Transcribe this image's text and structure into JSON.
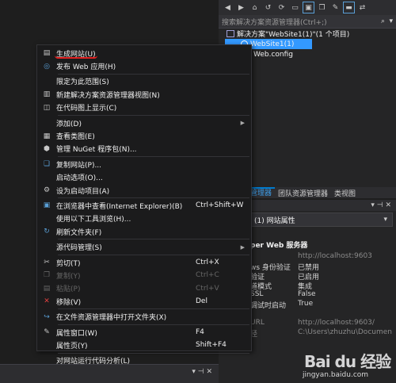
{
  "solution_explorer": {
    "search_placeholder": "搜索解决方案资源管理器(Ctrl+;)",
    "toolbar_icons": [
      "back-icon",
      "forward-icon",
      "home-icon",
      "history-icon",
      "refresh-icon",
      "collapse-icon",
      "filter-icon",
      "copy-icon",
      "wrench-icon",
      "preview-icon",
      "sync-icon"
    ],
    "tree": {
      "solution": "解决方案\"WebSite1(1)\"(1 个项目)",
      "website": "WebSite1(1)",
      "config": "Web.config"
    },
    "tabs": [
      "解决方案资源管理器",
      "团队资源管理器",
      "类视图"
    ],
    "tab_visible_fragment": "方案资源管理器"
  },
  "properties": {
    "title_fragment": "属性",
    "combo_value": "(1) 网站属性",
    "section": "per Web 服务器",
    "rows": [
      {
        "name": "",
        "value": "http://localhost:9603",
        "dim": true
      },
      {
        "name": "ws 身份验证",
        "value": "已禁用",
        "dim": false
      },
      {
        "name": "验证",
        "value": "已启用",
        "dim": false
      },
      {
        "name": "道模式",
        "value": "集成",
        "dim": false
      },
      {
        "name": "SSL",
        "value": "False",
        "dim": false
      },
      {
        "name": "调试时启动",
        "value": "True",
        "dim": false
      },
      {
        "name": "",
        "value": "",
        "dim": false
      },
      {
        "name": "URL",
        "value": "http://localhost:9603/",
        "dim": true
      },
      {
        "name": "径",
        "value": "C:\\Users\\zhuzhu\\Documen",
        "dim": true
      }
    ]
  },
  "context_menu": {
    "items": [
      {
        "id": "build-site",
        "icon": "build-icon",
        "label": "生成网站(U)",
        "shortcut": "",
        "submenu": false,
        "disabled": false
      },
      {
        "id": "publish",
        "icon": "globe-icon",
        "label": "发布 Web 应用(H)",
        "shortcut": "",
        "submenu": false,
        "disabled": false,
        "sep_after": true
      },
      {
        "id": "scope",
        "icon": "",
        "label": "限定为此范围(S)",
        "shortcut": "",
        "submenu": false,
        "disabled": false
      },
      {
        "id": "new-view",
        "icon": "new-window-icon",
        "label": "新建解决方案资源管理器视图(N)",
        "shortcut": "",
        "submenu": false,
        "disabled": false
      },
      {
        "id": "code-map",
        "icon": "code-map-icon",
        "label": "在代码图上显示(C)",
        "shortcut": "",
        "submenu": false,
        "disabled": false,
        "sep_after": true
      },
      {
        "id": "add",
        "icon": "",
        "label": "添加(D)",
        "shortcut": "",
        "submenu": true,
        "disabled": false
      },
      {
        "id": "class-diagram",
        "icon": "class-diagram-icon",
        "label": "查看类图(E)",
        "shortcut": "",
        "submenu": false,
        "disabled": false
      },
      {
        "id": "nuget",
        "icon": "nuget-icon",
        "label": "管理 NuGet 程序包(N)...",
        "shortcut": "",
        "submenu": false,
        "disabled": false,
        "sep_after": true
      },
      {
        "id": "copy-site",
        "icon": "copy-site-icon",
        "label": "复制网站(P)...",
        "shortcut": "",
        "submenu": false,
        "disabled": false
      },
      {
        "id": "startup-options",
        "icon": "",
        "label": "启动选项(O)...",
        "shortcut": "",
        "submenu": false,
        "disabled": false
      },
      {
        "id": "set-startup",
        "icon": "gear-icon",
        "label": "设为启动项目(A)",
        "shortcut": "",
        "submenu": false,
        "disabled": false,
        "sep_after": true
      },
      {
        "id": "view-in-browser",
        "icon": "browser-icon",
        "label": "在浏览器中查看(Internet Explorer)(B)",
        "shortcut": "Ctrl+Shift+W",
        "submenu": false,
        "disabled": false
      },
      {
        "id": "browse-with",
        "icon": "",
        "label": "使用以下工具浏览(H)...",
        "shortcut": "",
        "submenu": false,
        "disabled": false
      },
      {
        "id": "refresh-folder",
        "icon": "refresh-icon",
        "label": "刷新文件夹(F)",
        "shortcut": "",
        "submenu": false,
        "disabled": false,
        "sep_after": true
      },
      {
        "id": "source-control",
        "icon": "",
        "label": "源代码管理(S)",
        "shortcut": "",
        "submenu": true,
        "disabled": false,
        "sep_after": true
      },
      {
        "id": "cut",
        "icon": "scissors-icon",
        "label": "剪切(T)",
        "shortcut": "Ctrl+X",
        "submenu": false,
        "disabled": false
      },
      {
        "id": "copy",
        "icon": "copy-icon",
        "label": "复制(Y)",
        "shortcut": "Ctrl+C",
        "submenu": false,
        "disabled": true
      },
      {
        "id": "paste",
        "icon": "paste-icon",
        "label": "粘贴(P)",
        "shortcut": "Ctrl+V",
        "submenu": false,
        "disabled": true
      },
      {
        "id": "remove",
        "icon": "close-icon",
        "label": "移除(V)",
        "shortcut": "Del",
        "submenu": false,
        "disabled": false,
        "sep_after": true
      },
      {
        "id": "open-folder",
        "icon": "open-folder-icon",
        "label": "在文件资源管理器中打开文件夹(X)",
        "shortcut": "",
        "submenu": false,
        "disabled": false,
        "sep_after": true
      },
      {
        "id": "property-window",
        "icon": "wrench-icon",
        "label": "属性窗口(W)",
        "shortcut": "F4",
        "submenu": false,
        "disabled": false
      },
      {
        "id": "property-pages",
        "icon": "",
        "label": "属性页(Y)",
        "shortcut": "Shift+F4",
        "submenu": false,
        "disabled": false,
        "sep_after": true
      },
      {
        "id": "code-analysis",
        "icon": "",
        "label": "对网站运行代码分析(L)",
        "shortcut": "",
        "submenu": false,
        "disabled": false
      }
    ]
  },
  "watermark": {
    "logo": "Bai du 经验",
    "url": "jingyan.baidu.com"
  },
  "colors": {
    "accent": "#007acc",
    "selection": "#3399ff",
    "underline": "#e02020",
    "menu_bg": "#1b1b1c",
    "editor_bg": "#1e1e1e"
  }
}
